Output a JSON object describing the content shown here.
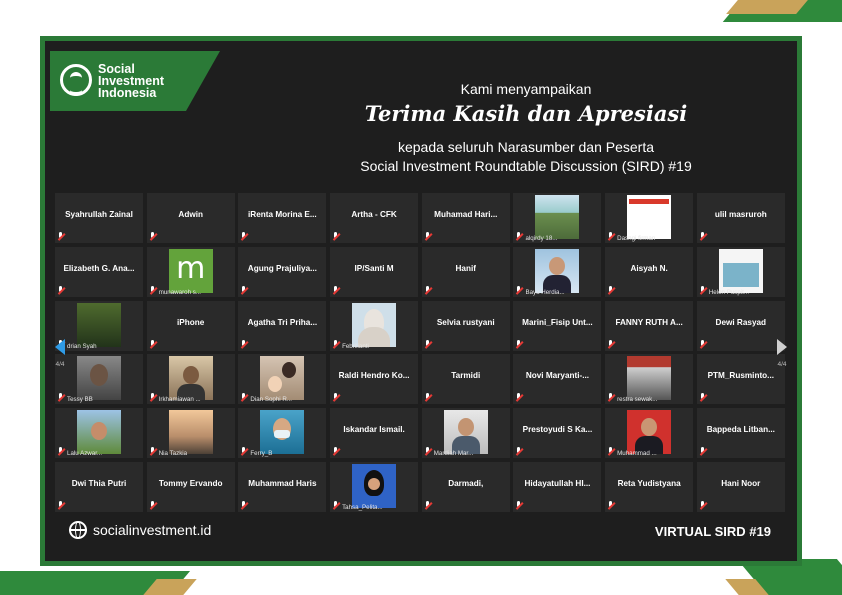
{
  "header": {
    "logo_line1": "Social",
    "logo_line2": "Investment",
    "logo_line3": "Indonesia",
    "line1": "Kami menyampaikan",
    "line2": "Terima Kasih dan Apresiasi",
    "line3": "kepada seluruh Narasumber dan Peserta",
    "line4": "Social Investment Roundtable Discussion (SIRD) #19"
  },
  "tiles": [
    {
      "name": "Syahrullah Zainal"
    },
    {
      "name": "Adwin"
    },
    {
      "name": "iRenta Morina E..."
    },
    {
      "name": "Artha - CFK"
    },
    {
      "name": "Muhamad Hari..."
    },
    {
      "caption": "alqirdy 18...",
      "photo": "ph-field"
    },
    {
      "caption": "Dasngi firman",
      "photo": "ph-banner"
    },
    {
      "name": "ulil masruroh"
    },
    {
      "name": "Elizabeth G. Ana..."
    },
    {
      "caption": "munawaroh s...",
      "photo": "ph-m",
      "photo_text": "m"
    },
    {
      "name": "Agung Prajuliya..."
    },
    {
      "name": "IP/Santi M"
    },
    {
      "name": "Hanif"
    },
    {
      "caption": "Bayu Herdia...",
      "photo": "ph-man"
    },
    {
      "name": "Aisyah N."
    },
    {
      "caption": "Helen Puspit...",
      "photo": "ph-poster"
    },
    {
      "caption": "drian Syah",
      "photo": "ph-tree"
    },
    {
      "name": "iPhone"
    },
    {
      "name": "Agatha Tri Priha..."
    },
    {
      "caption": "Febrilianti",
      "photo": "ph-hijab"
    },
    {
      "name": "Selvia rustyani"
    },
    {
      "name": "Marini_Fisip Unt..."
    },
    {
      "name": "FANNY RUTH A..."
    },
    {
      "name": "Dewi Rasyad"
    },
    {
      "caption": "Tessy BB",
      "photo": "ph-woman"
    },
    {
      "caption": "Irkhamiawan ...",
      "photo": "ph-room"
    },
    {
      "caption": "Dian Sophi R...",
      "photo": "ph-family"
    },
    {
      "name": "Raldi Hendro Ko..."
    },
    {
      "name": "Tarmidi"
    },
    {
      "name": "Novi Maryanti-..."
    },
    {
      "caption": "restra sewak...",
      "photo": "ph-group"
    },
    {
      "name": "PTM_Rusminto..."
    },
    {
      "caption": "Lalu Azwar...",
      "photo": "ph-outdoor"
    },
    {
      "caption": "Nia Tazkia",
      "photo": "ph-sunset"
    },
    {
      "caption": "Ferry_B",
      "photo": "ph-mask"
    },
    {
      "name": "Iskandar Ismail."
    },
    {
      "caption": "Mardiah Mar...",
      "photo": "ph-office"
    },
    {
      "name": "Prestoyudi S Ka..."
    },
    {
      "caption": "Muhammad ...",
      "photo": "ph-red"
    },
    {
      "name": "Bappeda Litban..."
    },
    {
      "name": "Dwi Thia Putri"
    },
    {
      "name": "Tommy Ervando"
    },
    {
      "name": "Muhammad Haris"
    },
    {
      "caption": "Tahsa_Pelita...",
      "photo": "ph-blue"
    },
    {
      "name": "Darmadi,"
    },
    {
      "name": "Hidayatullah HI..."
    },
    {
      "name": "Reta Yudistyana"
    },
    {
      "name": "Hani Noor"
    }
  ],
  "nav": {
    "left_page": "4/4",
    "right_page": "4/4"
  },
  "footer": {
    "website": "socialinvestment.id",
    "event": "VIRTUAL SIRD #19"
  },
  "colors": {
    "brand_green": "#2b7a37",
    "accent_gold": "#c9a35a",
    "panel_bg": "#1e1e1e",
    "tile_bg": "#2a2a2a",
    "muted_mic": "#e53935"
  }
}
